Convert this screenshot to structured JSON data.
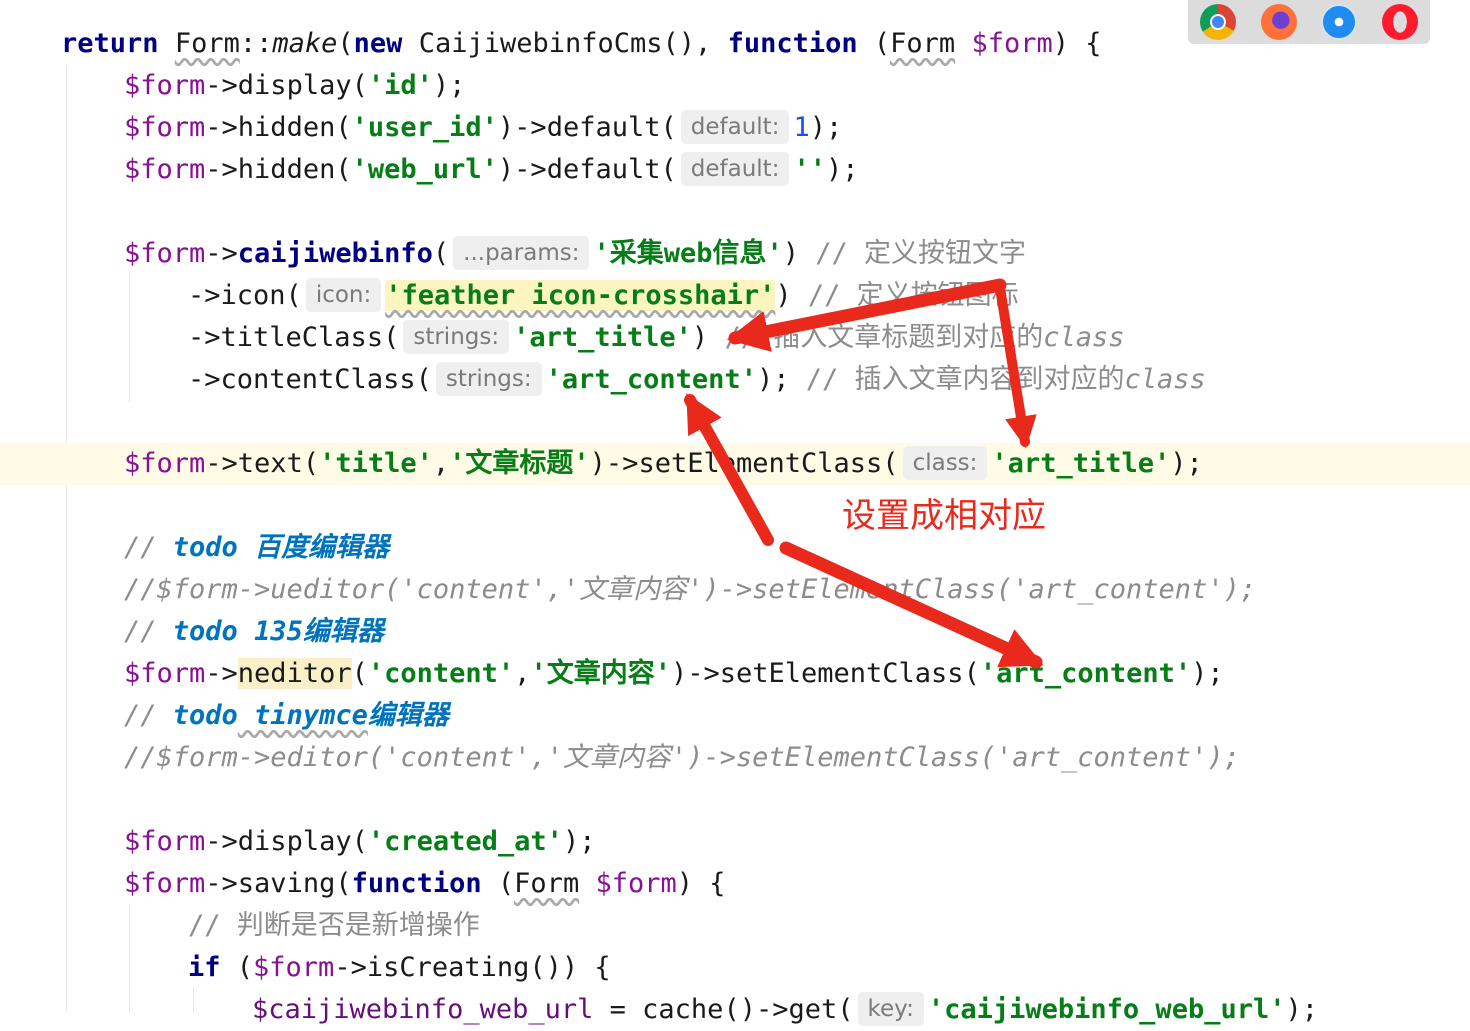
{
  "editor": {
    "lines": {
      "l0": {
        "ret": "return",
        "cls": "Form",
        "make": "make",
        "new": "new",
        "cms": "CaijiwebinfoCms",
        "func": "function",
        "param": "$form"
      },
      "l1": {
        "v": "$form",
        "m": "display",
        "s": "'id'"
      },
      "l2": {
        "v": "$form",
        "m": "hidden",
        "s": "'user_id'",
        "m2": "default",
        "hint": "default:",
        "n": "1"
      },
      "l3": {
        "v": "$form",
        "m": "hidden",
        "s": "'web_url'",
        "m2": "default",
        "hint": "default:",
        "s2": "''"
      },
      "l4": {
        "v": "$form",
        "m": "caijiwebinfo",
        "hint": "...params:",
        "s": "'采集web信息'",
        "c": "// 定义按钮文字"
      },
      "l5": {
        "m": "icon",
        "hint": "icon:",
        "s": "'feather icon-crosshair'",
        "c": "// 定义按钮图标"
      },
      "l6": {
        "m": "titleClass",
        "hint": "strings:",
        "s": "'art_title'",
        "c": "// 插入文章标题到对应的",
        "ci": "class"
      },
      "l7": {
        "m": "contentClass",
        "hint": "strings:",
        "s": "'art_content'",
        "c": "// 插入文章内容到对应的",
        "ci": "class"
      },
      "l8": {
        "v": "$form",
        "m": "text",
        "s1": "'title'",
        "s2": "'文章标题'",
        "m2": "setElementClass",
        "hint": "class:",
        "s3": "'art_title'"
      },
      "l9": {
        "c": "// ",
        "t": "todo",
        "r": " 百度编辑器"
      },
      "l10": {
        "text": "//$form->ueditor('content','文章内容')->setElementClass('art_content');"
      },
      "l11": {
        "c": "// ",
        "t": "todo",
        "r": " 135编辑器"
      },
      "l12": {
        "v": "$form",
        "m": "neditor",
        "s1": "'content'",
        "s2": "'文章内容'",
        "m2": "setElementClass",
        "s3": "'art_content'"
      },
      "l13": {
        "c": "// ",
        "t": "todo",
        "t2": " tinymce",
        "r": "编辑器"
      },
      "l14": {
        "text": "//$form->editor('content','文章内容')->setElementClass('art_content');"
      },
      "l15": {
        "v": "$form",
        "m": "display",
        "s": "'created_at'"
      },
      "l16": {
        "v": "$form",
        "m": "saving",
        "func": "function",
        "cls": "Form",
        "param": "$form"
      },
      "l17": {
        "c": "// 判断是否是新增操作"
      },
      "l18": {
        "kw": "if",
        "v": "$form",
        "m": "isCreating"
      },
      "l19": {
        "v": "$caijiwebinfo_web_url",
        "f1": "cache",
        "f2": "get",
        "hint": "key:",
        "s": "'caijiwebinfo_web_url'"
      }
    }
  },
  "annotation": {
    "callout": "设置成相对应",
    "color": "#e8291c"
  },
  "browser_icons": [
    "chrome-icon",
    "firefox-icon",
    "safari-icon",
    "opera-icon"
  ],
  "colors": {
    "keyword": "#000080",
    "string": "#067d17",
    "comment": "#8c8c8c",
    "todo": "#0073bf",
    "current_line": "#fffbe6"
  }
}
